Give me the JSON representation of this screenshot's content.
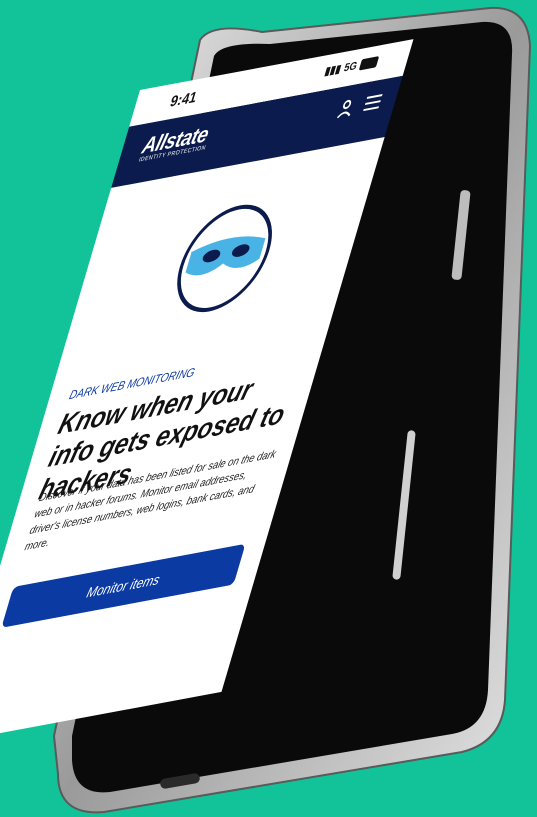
{
  "status_bar": {
    "time": "9:41",
    "network": "5G"
  },
  "header": {
    "brand_name": "Allstate",
    "brand_sub": "IDENTITY PROTECTION"
  },
  "main": {
    "eyebrow": "DARK WEB MONITORING",
    "headline": "Know when your info gets exposed to hackers",
    "body": "Discover if your data has been listed for sale on the dark web or in hacker forums. Monitor email addresses, driver's license numbers, web logins, bank cards, and more.",
    "cta_label": "Monitor items"
  },
  "colors": {
    "background": "#12c39a",
    "header": "#0b1b4d",
    "accent": "#0b3aa3",
    "mask": "#4ab3e6"
  }
}
